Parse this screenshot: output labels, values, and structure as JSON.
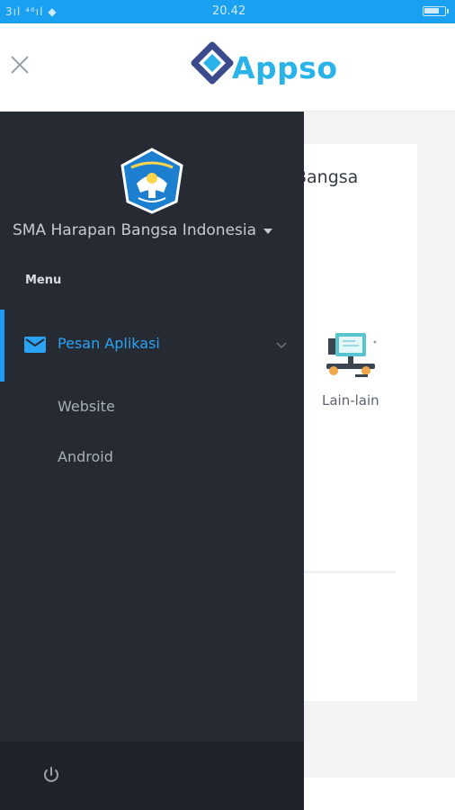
{
  "status_bar": {
    "signal": "3ıl ⁴⁶ıl ◆",
    "time": "20.42",
    "battery_level": 0.75,
    "color": "#1aa0f0"
  },
  "header": {
    "close_icon": "close-icon",
    "logo_text": "Appso",
    "logo_icon": "appso-logo-icon",
    "brand_color": "#29b3e9"
  },
  "background_card": {
    "title": "Bangsa",
    "item_label": "Lain-lain",
    "item_icon": "computer-desk-icon"
  },
  "drawer": {
    "school_logo_icon": "tut-wuri-handayani-emblem",
    "school_name": "SMA Harapan Bangsa Indonesia",
    "menu_heading": "Menu",
    "items": [
      {
        "label": "Pesan Aplikasi",
        "icon": "mail-icon",
        "active": true,
        "expanded": true,
        "children": [
          {
            "label": "Website"
          },
          {
            "label": "Android"
          }
        ]
      }
    ],
    "footer_icon": "power-icon",
    "accent_color": "#1e9bf0",
    "background": "#262a33"
  }
}
